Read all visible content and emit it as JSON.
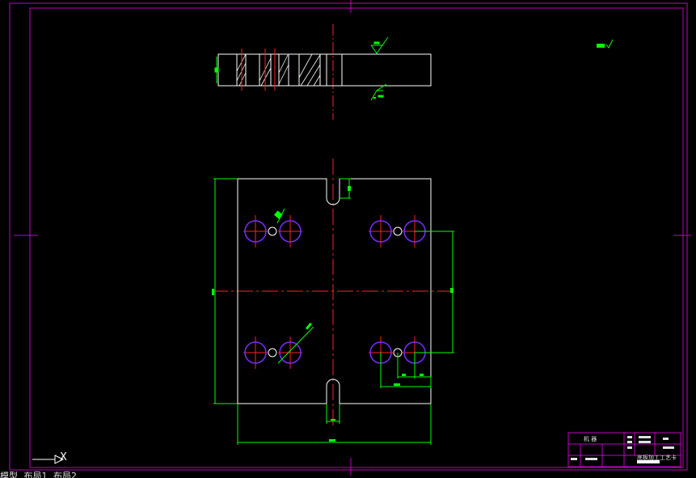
{
  "ucs": {
    "x_label": "X"
  },
  "tabs": [
    "模型",
    "布局1",
    "布局2"
  ],
  "title_block": {
    "header_left": "机 器",
    "drawing_name": "底板加工工艺卡"
  },
  "colors": {
    "background": "#000000",
    "frame": "#c000c0",
    "outline": "#ffffff",
    "centerline": "#ff2020",
    "dimension": "#00ff00",
    "hole": "#7a2cff"
  }
}
